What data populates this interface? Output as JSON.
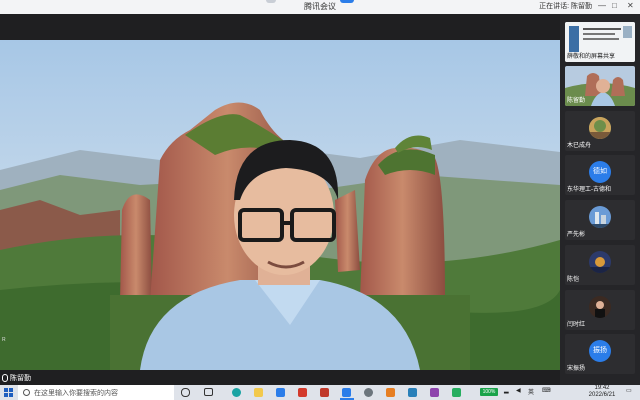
{
  "window": {
    "title": "腾讯会议",
    "speaking_label": "正在讲话: 陈留勤",
    "minimize": "—",
    "maximize": "□",
    "close": "✕"
  },
  "main_video": {
    "speaker_name": "陈留勤",
    "side_mark": "R"
  },
  "participants": [
    {
      "name": "薛敬和的屏幕共享",
      "type": "screen"
    },
    {
      "name": "陈留勤",
      "type": "video"
    },
    {
      "name": "木已成舟",
      "type": "photo"
    },
    {
      "name": "东华理工-古德和",
      "type": "avatar",
      "avatar_text": "德如",
      "color": "#2b7de9"
    },
    {
      "name": "严先彬",
      "type": "photo"
    },
    {
      "name": "陈恺",
      "type": "photo"
    },
    {
      "name": "闫时红",
      "type": "photo"
    },
    {
      "name": "宋振扬",
      "type": "avatar",
      "avatar_text": "振扬",
      "color": "#2b7de9"
    }
  ],
  "taskbar": {
    "search_placeholder": "在这里输入你要搜索的内容",
    "battery": "100%",
    "ime": "英",
    "time": "19:42",
    "date": "2022/6/21"
  }
}
